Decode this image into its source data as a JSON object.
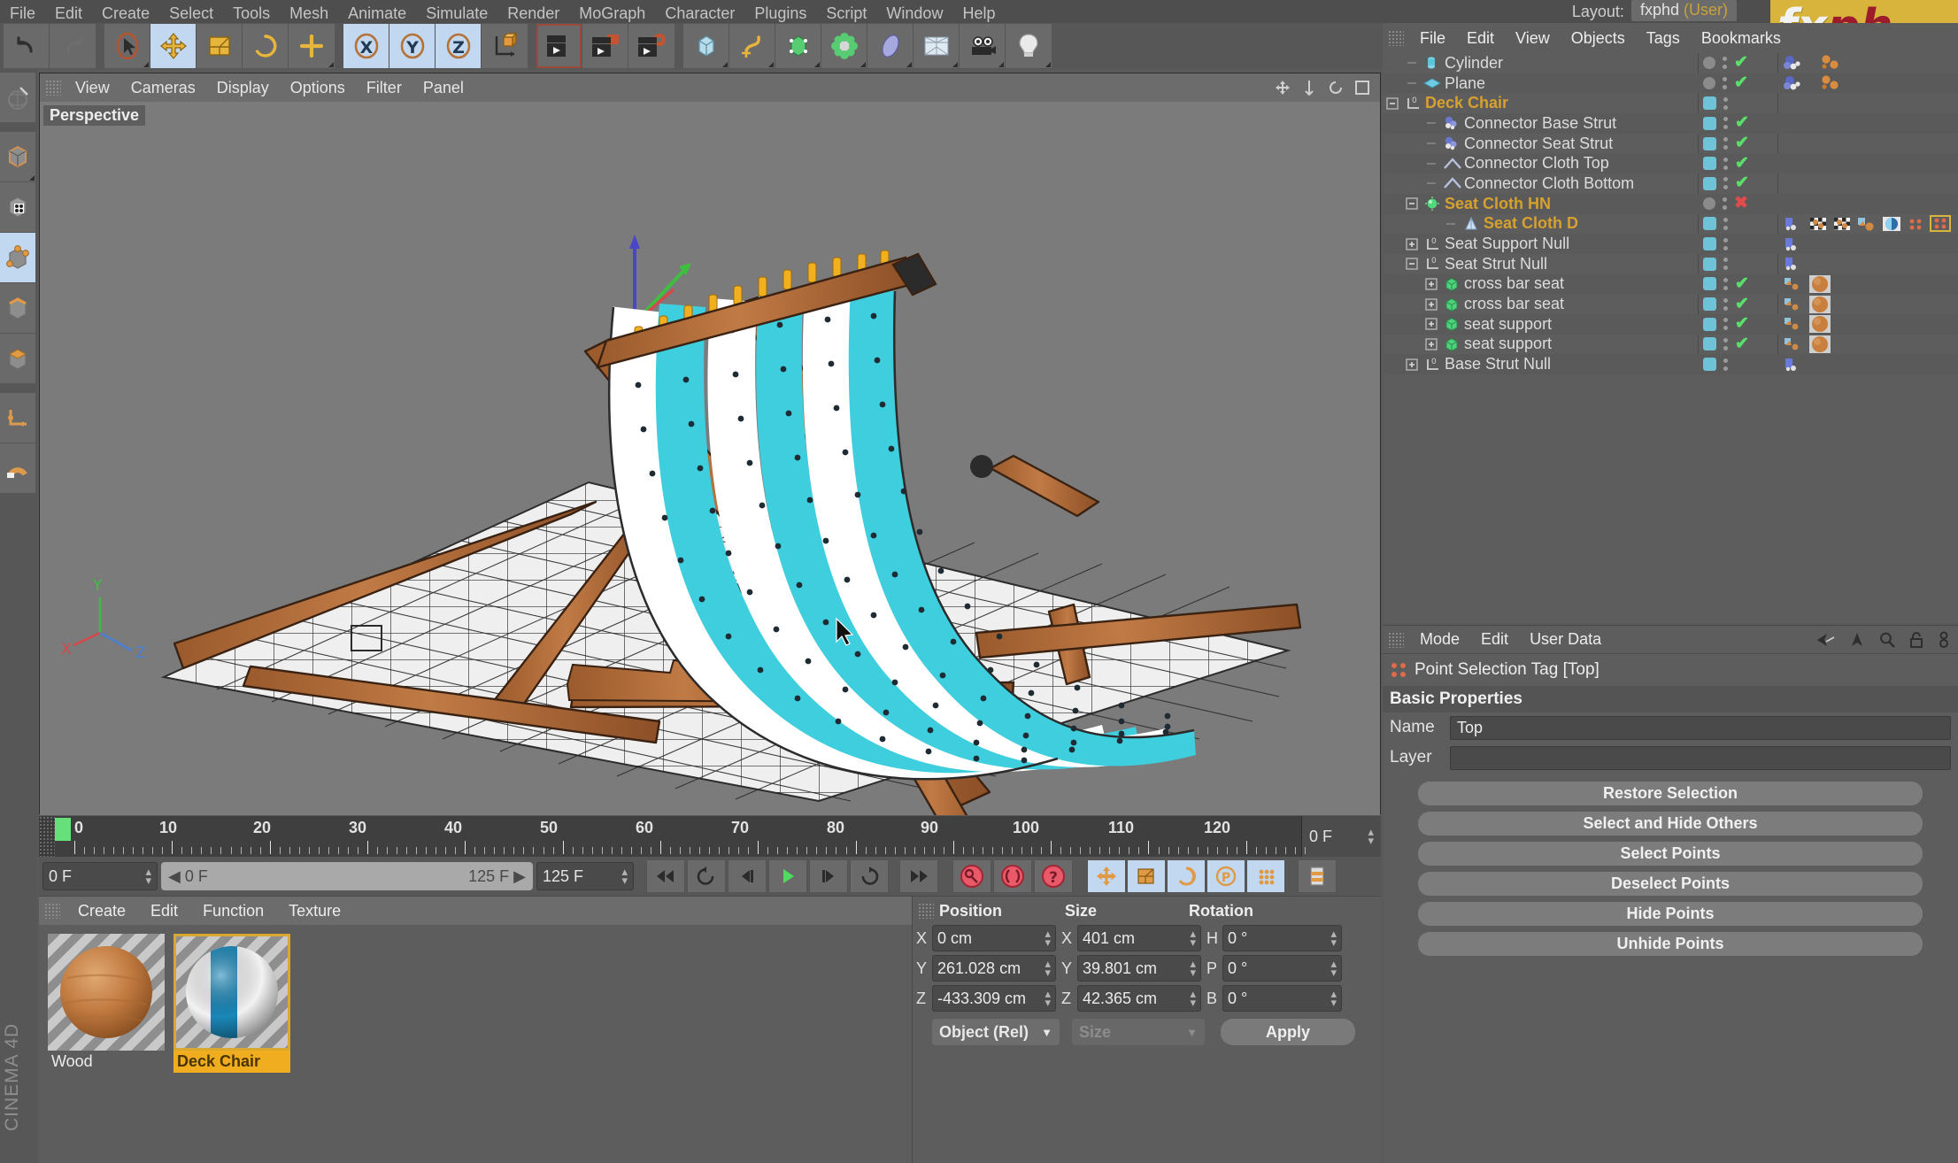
{
  "app": {
    "name": "CINEMA 4D",
    "vertical_label": "CINEMA 4D",
    "logo_fx": "fx",
    "logo_ph": "ph"
  },
  "top_menu": {
    "items": [
      "File",
      "Edit",
      "Create",
      "Select",
      "Tools",
      "Mesh",
      "Animate",
      "Simulate",
      "Render",
      "MoGraph",
      "Character",
      "Plugins",
      "Script",
      "Window",
      "Help"
    ],
    "layout_label": "Layout:",
    "layout_value": "fxphd",
    "layout_user": "(User)"
  },
  "viewport": {
    "menu": [
      "View",
      "Cameras",
      "Display",
      "Options",
      "Filter",
      "Panel"
    ],
    "label": "Perspective",
    "axis": {
      "x": "X",
      "y": "Y",
      "z": "Z"
    }
  },
  "timeline": {
    "ticks": [
      "0",
      "10",
      "20",
      "30",
      "40",
      "50",
      "60",
      "70",
      "80",
      "90",
      "100",
      "110",
      "120"
    ],
    "current_frame_right": "0 F",
    "current_frame_left": "0 F",
    "range_start": "0 F",
    "range_end": "125 F",
    "max_frame": "125 F"
  },
  "playback": {
    "buttons": [
      {
        "name": "go-to-start",
        "glyph": "⏮"
      },
      {
        "name": "loop-back",
        "glyph": "↺"
      },
      {
        "name": "previous-frame",
        "glyph": "◀|"
      },
      {
        "name": "play",
        "glyph": "▶"
      },
      {
        "name": "next-frame",
        "glyph": "|▶"
      },
      {
        "name": "loop-forward",
        "glyph": "↻"
      },
      {
        "name": "go-to-end",
        "glyph": "⏭"
      }
    ],
    "record_buttons": [
      "record-active-objects",
      "autokeying",
      "keyframe-selection"
    ],
    "key_toggles": [
      "position-key",
      "scale-key",
      "rotation-key",
      "parameter-key",
      "point-level-animation"
    ]
  },
  "material_manager": {
    "menu": [
      "Create",
      "Edit",
      "Function",
      "Texture"
    ],
    "materials": [
      {
        "name": "Wood",
        "selected": false
      },
      {
        "name": "Deck Chair",
        "selected": true
      }
    ]
  },
  "coordinates": {
    "headers": [
      "Position",
      "Size",
      "Rotation"
    ],
    "position": [
      {
        "axis": "X",
        "value": "0 cm"
      },
      {
        "axis": "Y",
        "value": "261.028 cm"
      },
      {
        "axis": "Z",
        "value": "-433.309 cm"
      }
    ],
    "size": [
      {
        "axis": "X",
        "value": "401 cm"
      },
      {
        "axis": "Y",
        "value": "39.801 cm"
      },
      {
        "axis": "Z",
        "value": "42.365 cm"
      }
    ],
    "rotation": [
      {
        "axis": "H",
        "value": "0 °"
      },
      {
        "axis": "P",
        "value": "0 °"
      },
      {
        "axis": "B",
        "value": "0 °"
      }
    ],
    "mode_dropdown": "Object (Rel)",
    "size_dropdown": "Size",
    "apply_button": "Apply"
  },
  "object_manager": {
    "menu": [
      "File",
      "Edit",
      "View",
      "Objects",
      "Tags",
      "Bookmarks"
    ],
    "rows": [
      {
        "label": "Cylinder",
        "indent": 1,
        "icon": "cylinder-icon",
        "expander": "",
        "visdot": "dot",
        "check": "ok",
        "highlight": false,
        "tags": [
          "blue-cluster",
          "orange-cluster"
        ]
      },
      {
        "label": "Plane",
        "indent": 1,
        "icon": "plane-icon",
        "expander": "",
        "visdot": "dot",
        "check": "ok",
        "highlight": false,
        "tags": [
          "blue-cluster",
          "orange-cluster"
        ]
      },
      {
        "label": "Deck Chair",
        "indent": 0,
        "icon": "null-icon",
        "expander": "minus",
        "visdot": "square",
        "check": "",
        "highlight": true,
        "tags": []
      },
      {
        "label": "Connector Base Strut",
        "indent": 2,
        "icon": "connector-icon",
        "expander": "",
        "visdot": "square",
        "check": "ok",
        "highlight": false,
        "tags": []
      },
      {
        "label": "Connector Seat Strut",
        "indent": 2,
        "icon": "connector-icon",
        "expander": "",
        "visdot": "square",
        "check": "ok",
        "highlight": false,
        "tags": []
      },
      {
        "label": "Connector Cloth Top",
        "indent": 2,
        "icon": "spline-icon",
        "expander": "",
        "visdot": "square",
        "check": "ok",
        "highlight": false,
        "tags": []
      },
      {
        "label": "Connector Cloth Bottom",
        "indent": 2,
        "icon": "spline-icon",
        "expander": "",
        "visdot": "square",
        "check": "ok",
        "highlight": false,
        "tags": []
      },
      {
        "label": "Seat Cloth HN",
        "indent": 1,
        "icon": "hair-icon",
        "expander": "minus",
        "visdot": "dot",
        "check": "no",
        "highlight": true,
        "tags": []
      },
      {
        "label": "Seat Cloth D",
        "indent": 3,
        "icon": "deformer-icon",
        "expander": "",
        "visdot": "square",
        "check": "",
        "highlight": true,
        "tags": [
          "blue-tag",
          "checker-tag",
          "checker-tag",
          "material-tag",
          "phong-tag",
          "selection-tag",
          "selection-tag-sel",
          "selection-tag"
        ]
      },
      {
        "label": "Seat Support Null",
        "indent": 1,
        "icon": "null-icon",
        "expander": "plus",
        "visdot": "square",
        "check": "",
        "highlight": false,
        "tags": [
          "blue-tag"
        ]
      },
      {
        "label": "Seat Strut Null",
        "indent": 1,
        "icon": "null-icon",
        "expander": "minus",
        "visdot": "square",
        "check": "",
        "highlight": false,
        "tags": [
          "blue-tag"
        ]
      },
      {
        "label": "cross bar seat",
        "indent": 2,
        "icon": "cube-green-icon",
        "expander": "plus",
        "visdot": "square",
        "check": "ok",
        "highlight": false,
        "tags": [
          "mat-small",
          "wood-sphere"
        ]
      },
      {
        "label": "cross bar seat",
        "indent": 2,
        "icon": "cube-green-icon",
        "expander": "plus",
        "visdot": "square",
        "check": "ok",
        "highlight": false,
        "tags": [
          "mat-small",
          "wood-sphere"
        ]
      },
      {
        "label": "seat support",
        "indent": 2,
        "icon": "cube-green-icon",
        "expander": "plus",
        "visdot": "square",
        "check": "ok",
        "highlight": false,
        "tags": [
          "mat-small",
          "wood-sphere"
        ]
      },
      {
        "label": "seat support",
        "indent": 2,
        "icon": "cube-green-icon",
        "expander": "plus",
        "visdot": "square",
        "check": "ok",
        "highlight": false,
        "tags": [
          "mat-small",
          "wood-sphere"
        ]
      },
      {
        "label": "Base Strut Null",
        "indent": 1,
        "icon": "null-icon",
        "expander": "plus",
        "visdot": "square",
        "check": "",
        "highlight": false,
        "tags": [
          "blue-tag"
        ]
      }
    ]
  },
  "attribute_manager": {
    "menu": [
      "Mode",
      "Edit",
      "User Data"
    ],
    "tag_title": "Point Selection Tag [Top]",
    "section": "Basic Properties",
    "fields": [
      {
        "label": "Name",
        "value": "Top"
      },
      {
        "label": "Layer",
        "value": ""
      }
    ],
    "buttons": [
      "Restore Selection",
      "Select and Hide Others",
      "Select Points",
      "Deselect Points",
      "Hide Points",
      "Unhide Points"
    ]
  },
  "colors": {
    "accent_orange": "#d6a12e",
    "check_green": "#5ae06a",
    "x_red": "#e04b4b",
    "tag_cyan": "#6ec3d6",
    "selection_blue": "#c2d8f0",
    "cloth_cyan": "#3ecede",
    "wood_brown": "#b5703c",
    "logo_yellow": "#d8b43c"
  }
}
